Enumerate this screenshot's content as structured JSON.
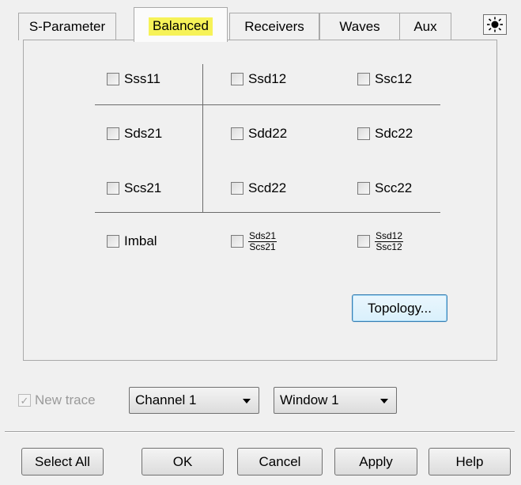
{
  "tabs": [
    {
      "label": "S-Parameter",
      "active": false
    },
    {
      "label": "Balanced",
      "active": true
    },
    {
      "label": "Receivers",
      "active": false
    },
    {
      "label": "Waves",
      "active": false
    },
    {
      "label": "Aux",
      "active": false
    }
  ],
  "accent": {
    "tab_highlight": "#f6f258",
    "focus_border": "#3c7fb1"
  },
  "icons": {
    "sun": "sun-icon"
  },
  "parameters": {
    "row1": [
      "Sss11",
      "Ssd12",
      "Ssc12"
    ],
    "row2": [
      "Sds21",
      "Sdd22",
      "Sdc22"
    ],
    "row3": [
      "Scs21",
      "Scd22",
      "Scc22"
    ],
    "row4": {
      "imbal": "Imbal",
      "ratio1": {
        "numerator": "Sds21",
        "denominator": "Scs21"
      },
      "ratio2": {
        "numerator": "Ssd12",
        "denominator": "Ssc12"
      }
    }
  },
  "topology_button": "Topology...",
  "new_trace": {
    "label": "New trace",
    "checked": true,
    "enabled": false
  },
  "channel_select": {
    "value": "Channel 1"
  },
  "window_select": {
    "value": "Window 1"
  },
  "footer": {
    "select_all": "Select All",
    "ok": "OK",
    "cancel": "Cancel",
    "apply": "Apply",
    "help": "Help"
  }
}
